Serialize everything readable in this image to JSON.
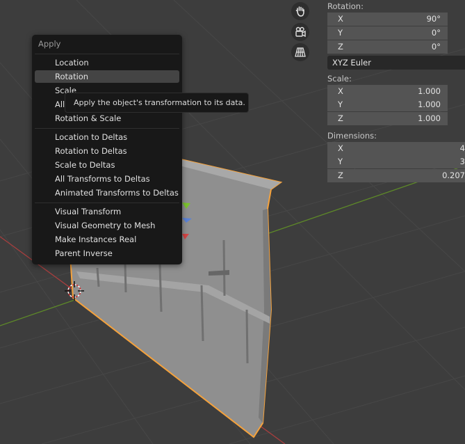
{
  "menu": {
    "title": "Apply",
    "items": [
      {
        "label": "Location"
      },
      {
        "label": "Rotation"
      },
      {
        "label": "Scale"
      },
      {
        "label": "All"
      },
      {
        "label": "Rotation & Scale"
      },
      {
        "label": "Location to Deltas"
      },
      {
        "label": "Rotation to Deltas"
      },
      {
        "label": "Scale to Deltas"
      },
      {
        "label": "All Transforms to Deltas"
      },
      {
        "label": "Animated Transforms to Deltas"
      },
      {
        "label": "Visual Transform"
      },
      {
        "label": "Visual Geometry to Mesh"
      },
      {
        "label": "Make Instances Real"
      },
      {
        "label": "Parent Inverse"
      }
    ]
  },
  "tooltip": "Apply the object's transformation to its data.",
  "properties": {
    "rotation": {
      "label": "Rotation:",
      "x": {
        "axis": "X",
        "value": "90°"
      },
      "y": {
        "axis": "Y",
        "value": "0°"
      },
      "z": {
        "axis": "Z",
        "value": "0°"
      },
      "mode": "XYZ Euler"
    },
    "scale": {
      "label": "Scale:",
      "x": {
        "axis": "X",
        "value": "1.000"
      },
      "y": {
        "axis": "Y",
        "value": "1.000"
      },
      "z": {
        "axis": "Z",
        "value": "1.000"
      }
    },
    "dimensions": {
      "label": "Dimensions:",
      "x": {
        "axis": "X",
        "value": "4"
      },
      "y": {
        "axis": "Y",
        "value": "3"
      },
      "z": {
        "axis": "Z",
        "value": "0.207"
      }
    }
  },
  "gizmos": [
    "hand-pan-icon",
    "camera-icon",
    "perspective-grid-icon"
  ],
  "colors": {
    "selection_outline": "#f5a23c",
    "mesh": "#9a9a9a",
    "axis_x": "#c84b4b",
    "axis_y": "#6a9a2a",
    "viewport_bg": "#3d3d3d"
  }
}
